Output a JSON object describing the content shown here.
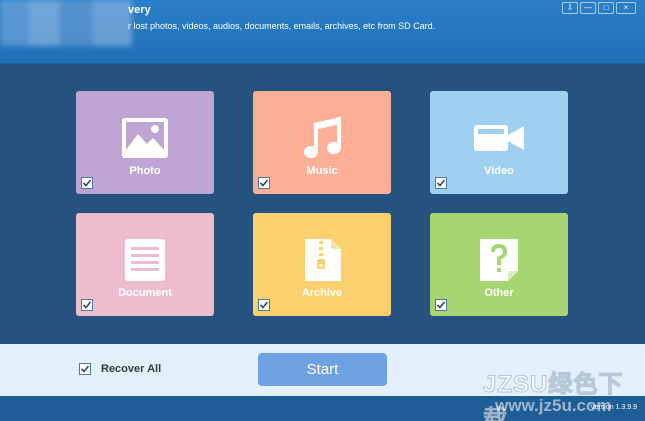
{
  "window": {
    "title": "very",
    "subtitle": "r lost photos, videos, audios, documents, emails, archives, etc from SD Card.",
    "controls": [
      "⇩",
      "—",
      "□",
      "×"
    ]
  },
  "tiles": [
    {
      "label": "Photo",
      "checked": true
    },
    {
      "label": "Music",
      "checked": true
    },
    {
      "label": "Video",
      "checked": true
    },
    {
      "label": "Document",
      "checked": true
    },
    {
      "label": "Archive",
      "checked": true
    },
    {
      "label": "Other",
      "checked": true
    }
  ],
  "bottom": {
    "recover_all_label": "Recover All",
    "recover_all_checked": true,
    "start_label": "Start"
  },
  "footer": {
    "version": "Version 1.3.9.9"
  },
  "watermark": {
    "line1": "JZSU绿色下载",
    "line2": "www.jz5u.com"
  },
  "colors": {
    "header": "#2b7fc8",
    "main_bg": "#25527f",
    "photo": "#bea5d4",
    "music": "#fdae97",
    "video": "#9fd0f1",
    "document": "#eebdcc",
    "archive": "#fdd06e",
    "other": "#a5d672",
    "start_button": "#6fa2e3"
  }
}
